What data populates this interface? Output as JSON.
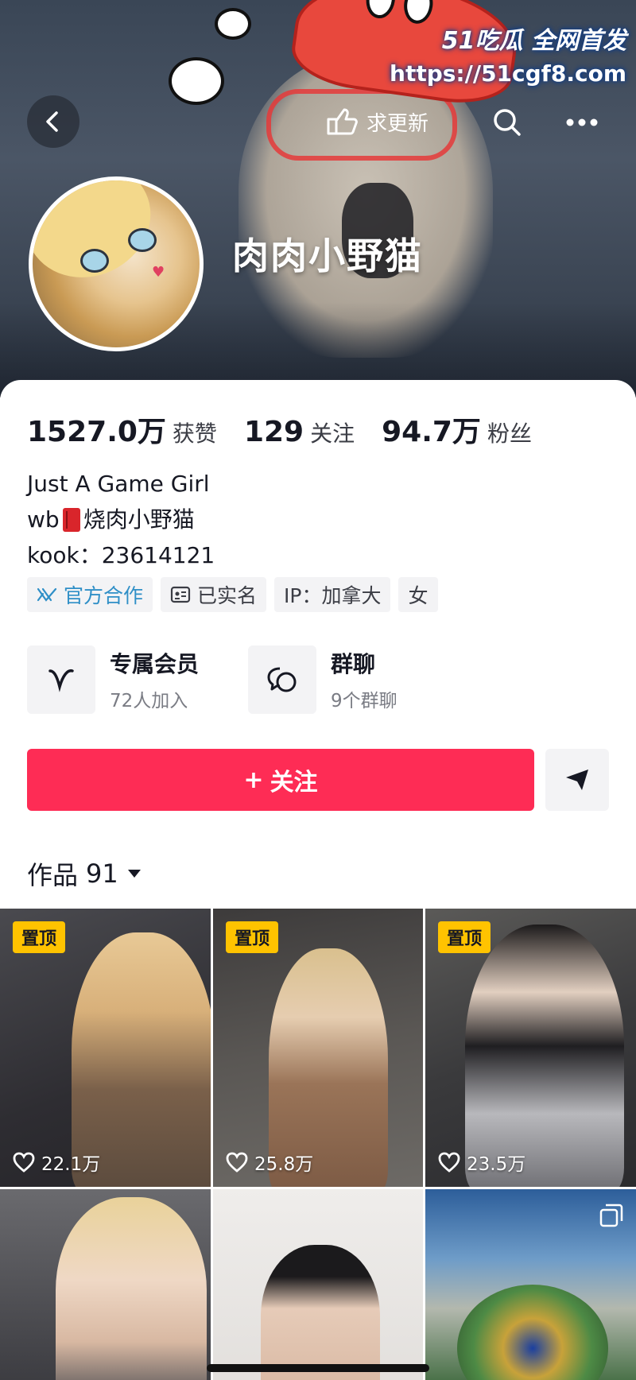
{
  "watermark": {
    "line1": "51吃瓜 全网首发",
    "line2": "https://51cgf8.com"
  },
  "topbar": {
    "request_update_label": "求更新"
  },
  "profile": {
    "display_name": "肉肉小野猫"
  },
  "stats": [
    {
      "value": "1527.0万",
      "label": "获赞"
    },
    {
      "value": "129",
      "label": "关注"
    },
    {
      "value": "94.7万",
      "label": "粉丝"
    }
  ],
  "bio": {
    "line1": "Just A Game Girl",
    "line2_prefix": "wb",
    "line2_suffix": "烧肉小野猫",
    "line3": "kook：23614121"
  },
  "tags": [
    "官方合作",
    "已实名",
    "IP：加拿大",
    "女"
  ],
  "features": [
    {
      "title": "专属会员",
      "subtitle": "72人加入"
    },
    {
      "title": "群聊",
      "subtitle": "9个群聊"
    }
  ],
  "actions": {
    "follow_label": "关注",
    "follow_prefix": "+"
  },
  "works": {
    "label": "作品",
    "count": "91"
  },
  "videos": [
    {
      "pinned": true,
      "pin_label": "置顶",
      "likes": "22.1万"
    },
    {
      "pinned": true,
      "pin_label": "置顶",
      "likes": "25.8万"
    },
    {
      "pinned": true,
      "pin_label": "置顶",
      "likes": "23.5万"
    },
    {
      "pinned": false,
      "likes": ""
    },
    {
      "pinned": false,
      "likes": ""
    },
    {
      "pinned": false,
      "likes": ""
    }
  ],
  "colors": {
    "accent": "#fe2c55",
    "pin_badge": "#ffc300",
    "official_tag": "#2f8fc7"
  }
}
